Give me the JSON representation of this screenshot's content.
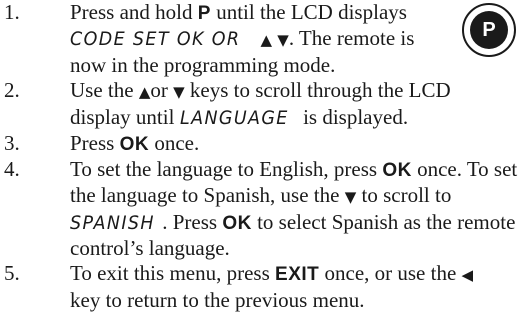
{
  "button_icon": {
    "label": "P"
  },
  "steps": [
    {
      "number": "1.",
      "segments": [
        {
          "text": "Press and hold "
        },
        {
          "text": "P",
          "style": "key"
        },
        {
          "text": " until the LCD displays"
        },
        {
          "text": "\n"
        },
        {
          "text": "CODE SET OK OR",
          "style": "lcd"
        },
        {
          "text": " "
        },
        {
          "text": "▲",
          "style": "arrow"
        },
        {
          "text": " "
        },
        {
          "text": "▼",
          "style": "arrow"
        },
        {
          "text": ". The remote is"
        },
        {
          "text": "\n"
        },
        {
          "text": "now in the programming mode."
        }
      ]
    },
    {
      "number": "2.",
      "segments": [
        {
          "text": "Use the "
        },
        {
          "text": "▲",
          "style": "arrow"
        },
        {
          "text": "or "
        },
        {
          "text": "▼",
          "style": "arrow"
        },
        {
          "text": " keys to scroll through the LCD"
        },
        {
          "text": "\n"
        },
        {
          "text": "display until "
        },
        {
          "text": "LANGUAGE",
          "style": "lcd"
        },
        {
          "text": " is displayed."
        }
      ]
    },
    {
      "number": "3.",
      "segments": [
        {
          "text": "Press "
        },
        {
          "text": "OK",
          "style": "key"
        },
        {
          "text": " once."
        }
      ]
    },
    {
      "number": "4.",
      "segments": [
        {
          "text": "To set the language to English, press "
        },
        {
          "text": "OK",
          "style": "key"
        },
        {
          "text": " once. To set"
        },
        {
          "text": "\n"
        },
        {
          "text": "the language to Spanish, use the "
        },
        {
          "text": "▼",
          "style": "arrow"
        },
        {
          "text": " to scroll to"
        },
        {
          "text": "\n"
        },
        {
          "text": "SPANISH",
          "style": "lcd"
        },
        {
          "text": ". Press "
        },
        {
          "text": "OK",
          "style": "key"
        },
        {
          "text": " to select Spanish as the remote"
        },
        {
          "text": "\n"
        },
        {
          "text": "control’s language."
        }
      ]
    },
    {
      "number": "5.",
      "segments": [
        {
          "text": "To exit this menu, press "
        },
        {
          "text": "EXIT",
          "style": "key"
        },
        {
          "text": " once, or use the "
        },
        {
          "text": "◀",
          "style": "arrow"
        },
        {
          "text": "\n"
        },
        {
          "text": "key to return to the previous menu."
        }
      ]
    }
  ]
}
